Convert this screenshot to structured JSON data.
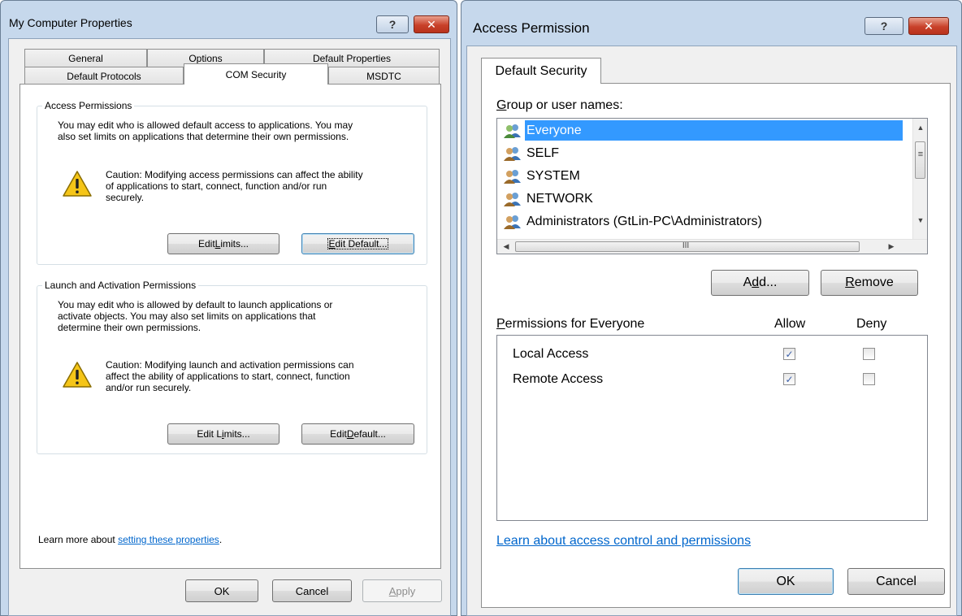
{
  "left_dialog": {
    "title": "My Computer Properties",
    "help_glyph": "?",
    "close_glyph": "✕",
    "tabs_row1": [
      "General",
      "Options",
      "Default Properties"
    ],
    "tabs_row2": [
      "Default Protocols",
      "COM Security",
      "MSDTC"
    ],
    "active_tab": "COM Security",
    "access_group": {
      "label": "Access Permissions",
      "description_lines": [
        "You may edit who is allowed default access to applications. You may",
        "also set limits on applications that determine their own permissions."
      ],
      "caution_lines": [
        "Caution: Modifying access permissions can affect the ability",
        "of applications to start, connect, function and/or run",
        "securely."
      ],
      "edit_limits": {
        "before": "Edit ",
        "key": "L",
        "after": "imits..."
      },
      "edit_default": {
        "before": "",
        "key": "E",
        "after": "dit Default..."
      }
    },
    "launch_group": {
      "label": "Launch and Activation Permissions",
      "description_lines": [
        "You may edit who is allowed by default to launch applications or",
        "activate objects. You may also set limits on applications that",
        "determine their own permissions."
      ],
      "caution_lines": [
        "Caution: Modifying launch and activation permissions can",
        "affect the ability of applications to start, connect, function",
        "and/or run securely."
      ],
      "edit_limits": {
        "before": "Edit L",
        "key": "i",
        "after": "mits..."
      },
      "edit_default": {
        "before": "Edit ",
        "key": "D",
        "after": "efault..."
      }
    },
    "learn_more_prefix": "Learn more about ",
    "learn_more_link": "setting these properties",
    "learn_more_suffix": ".",
    "buttons": {
      "ok": "OK",
      "cancel": "Cancel",
      "apply": {
        "key": "A",
        "after": "pply"
      }
    }
  },
  "right_dialog": {
    "title": "Access Permission",
    "help_glyph": "?",
    "close_glyph": "✕",
    "tab": "Default Security",
    "group_label": {
      "key": "G",
      "after": "roup or user names:"
    },
    "users": [
      "Everyone",
      "SELF",
      "SYSTEM",
      "NETWORK",
      "Administrators (GtLin-PC\\Administrators)"
    ],
    "selected_user": "Everyone",
    "scroll_glyphs": {
      "up": "▲",
      "down": "▼",
      "left": "◀",
      "right": "▶",
      "grip": "≡",
      "hgrip": "III"
    },
    "add_button": {
      "before": "A",
      "key": "d",
      "after": "d..."
    },
    "remove_button": {
      "key": "R",
      "after": "emove"
    },
    "permissions_label": {
      "key": "P",
      "after": "ermissions for Everyone"
    },
    "allow_header": "Allow",
    "deny_header": "Deny",
    "permissions": [
      {
        "name": "Local Access",
        "allow": true,
        "deny": false
      },
      {
        "name": "Remote Access",
        "allow": true,
        "deny": false
      }
    ],
    "check_glyph": "✓",
    "learn_link": "Learn about access control and permissions",
    "ok": "OK",
    "cancel": "Cancel"
  }
}
